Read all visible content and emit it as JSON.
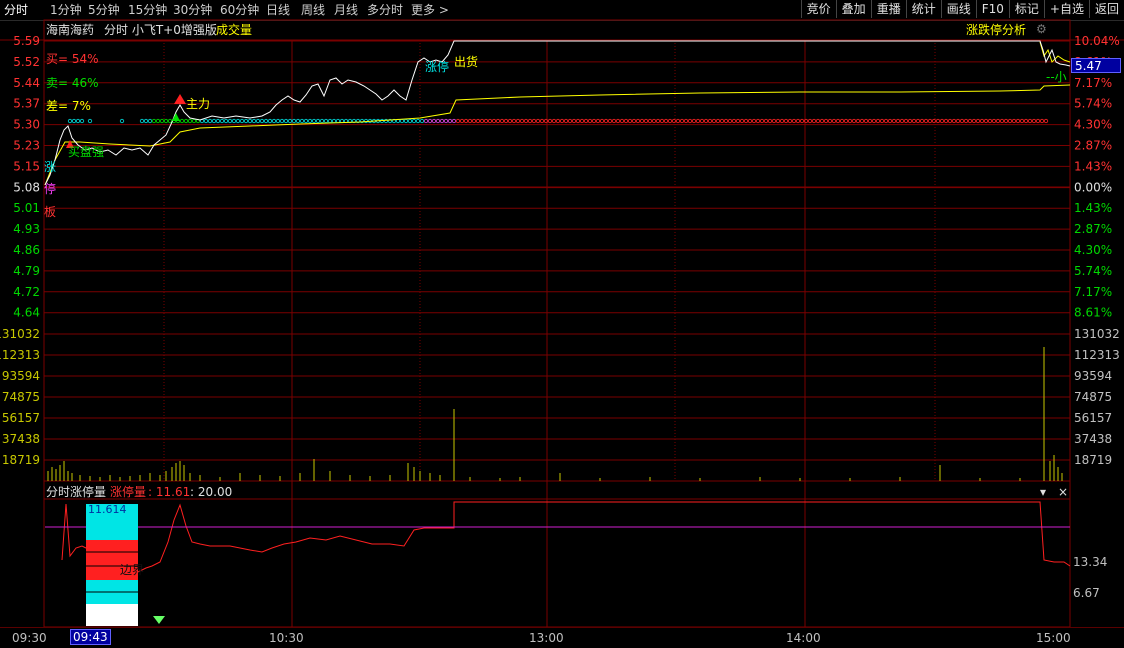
{
  "tabs": [
    "分时",
    "1分钟",
    "5分钟",
    "15分钟",
    "30分钟",
    "60分钟",
    "日线",
    "周线",
    "月线",
    "多分时",
    "更多 >"
  ],
  "right_buttons": [
    "竞价",
    "叠加",
    "重播",
    "统计",
    "画线",
    "F10",
    "标记",
    "+自选",
    "返回"
  ],
  "header": {
    "stock_name": "海南海药",
    "chart_title": "分时 小飞T+0增强版",
    "volume_label": "成交量",
    "right_title": "涨跌停分析",
    "settings_icon": "gear-icon"
  },
  "signals": {
    "buy": "买= 54%",
    "sell": "卖= 46%",
    "diff": "差= 7%",
    "zhuli": "主力",
    "maizhong": "买盘强",
    "chuhuo": "出货",
    "limit_up": "涨停",
    "boundary": "边界",
    "markers": [
      "涨",
      "停",
      "板"
    ],
    "small_label": "--小"
  },
  "price_axis": [
    "5.59",
    "5.52",
    "5.44",
    "5.37",
    "5.30",
    "5.23",
    "5.15",
    "5.08",
    "5.01",
    "4.93",
    "4.86",
    "4.79",
    "4.72",
    "4.64"
  ],
  "pct_axis": [
    "10.04%",
    "8.61%",
    "7.17%",
    "5.74%",
    "4.30%",
    "2.87%",
    "1.43%",
    "0.00%",
    "1.43%",
    "2.87%",
    "4.30%",
    "5.74%",
    "7.17%",
    "8.61%"
  ],
  "current_price": "5.47",
  "volume_axis": [
    "131032",
    "112313",
    "93594",
    "74875",
    "56157",
    "37438",
    "18719"
  ],
  "indicator": {
    "title": "分时涨停量",
    "name": "涨停量",
    "value": ": 11.61",
    "value2": ": 20.00",
    "box_value": "11.614",
    "axis": [
      "13.34",
      "6.67"
    ]
  },
  "time_axis": [
    "09:30",
    "09:43",
    "10:30",
    "13:00",
    "14:00",
    "15:00"
  ],
  "colors": {
    "up": "#ff3232",
    "down": "#00d800",
    "grid": "#7a0000",
    "price": "#ffffff",
    "avg": "#ffff00",
    "volume": "#c8c800"
  }
}
